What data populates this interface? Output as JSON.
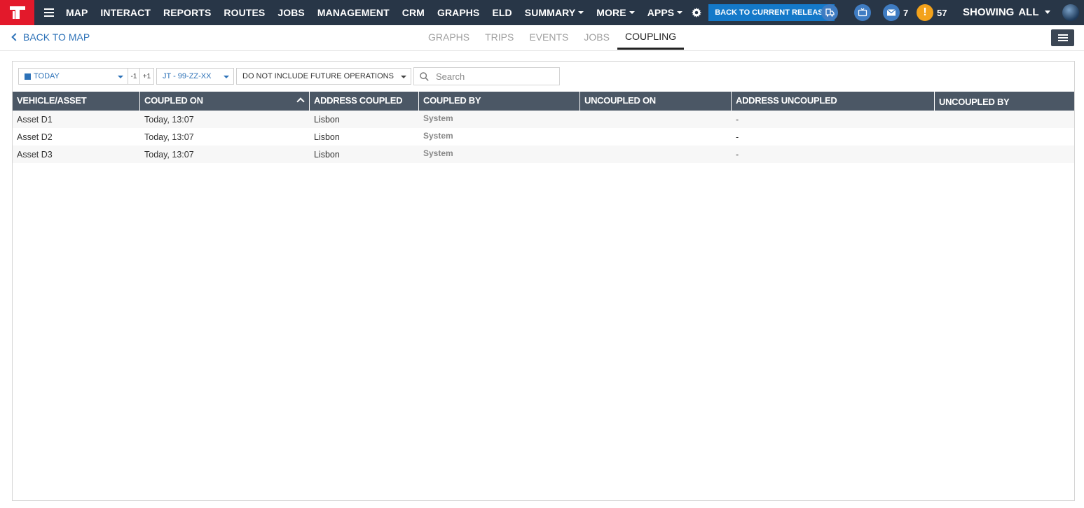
{
  "nav": {
    "items": [
      {
        "label": "MAP",
        "caret": false
      },
      {
        "label": "INTERACT",
        "caret": false
      },
      {
        "label": "REPORTS",
        "caret": false
      },
      {
        "label": "ROUTES",
        "caret": false
      },
      {
        "label": "JOBS",
        "caret": false
      },
      {
        "label": "MANAGEMENT",
        "caret": false
      },
      {
        "label": "CRM",
        "caret": false
      },
      {
        "label": "GRAPHS",
        "caret": false
      },
      {
        "label": "ELD",
        "caret": false
      },
      {
        "label": "SUMMARY",
        "caret": true
      },
      {
        "label": "MORE",
        "caret": true
      },
      {
        "label": "APPS",
        "caret": true
      }
    ],
    "release_button": "BACK TO CURRENT RELEASE",
    "messages_count": "7",
    "alerts_count": "57",
    "alert_glyph": "!",
    "showing_label": "SHOWING",
    "showing_value": "ALL",
    "colors": {
      "bar": "#283647",
      "logo": "#e3192b",
      "release": "#1479c9",
      "alert": "#f3a21b"
    }
  },
  "subheader": {
    "back_label": "BACK TO MAP",
    "tabs": [
      {
        "label": "GRAPHS",
        "active": false
      },
      {
        "label": "TRIPS",
        "active": false
      },
      {
        "label": "EVENTS",
        "active": false
      },
      {
        "label": "JOBS",
        "active": false
      },
      {
        "label": "COUPLING",
        "active": true
      }
    ]
  },
  "toolbar": {
    "date_value": "TODAY",
    "step_minus": "-1",
    "step_plus": "+1",
    "vehicle_value": "JT - 99-ZZ-XX",
    "future_value": "DO NOT INCLUDE FUTURE OPERATIONS",
    "search_placeholder": "Search"
  },
  "table": {
    "columns": [
      {
        "label": "VEHICLE/ASSET",
        "sorted": false
      },
      {
        "label": "COUPLED ON",
        "sorted": true
      },
      {
        "label": "ADDRESS COUPLED",
        "sorted": false
      },
      {
        "label": "COUPLED BY",
        "sorted": false
      },
      {
        "label": "UNCOUPLED ON",
        "sorted": false
      },
      {
        "label": "ADDRESS UNCOUPLED",
        "sorted": false
      },
      {
        "label": "UNCOUPLED BY",
        "sorted": false
      }
    ],
    "rows": [
      {
        "vehicle": "Asset D1",
        "coupled_on": "Today, 13:07",
        "address_coupled": "Lisbon",
        "coupled_by": "System",
        "uncoupled_on": "",
        "address_uncoupled": "-",
        "uncoupled_by": ""
      },
      {
        "vehicle": "Asset D2",
        "coupled_on": "Today, 13:07",
        "address_coupled": "Lisbon",
        "coupled_by": "System",
        "uncoupled_on": "",
        "address_uncoupled": "-",
        "uncoupled_by": ""
      },
      {
        "vehicle": "Asset D3",
        "coupled_on": "Today, 13:07",
        "address_coupled": "Lisbon",
        "coupled_by": "System",
        "uncoupled_on": "",
        "address_uncoupled": "-",
        "uncoupled_by": ""
      }
    ]
  }
}
